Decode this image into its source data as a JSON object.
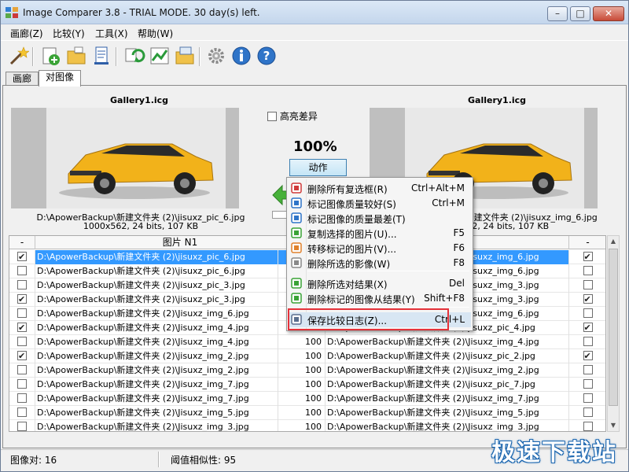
{
  "window": {
    "title": "Image Comparer 3.8 - TRIAL MODE. 30 day(s) left."
  },
  "menu": [
    {
      "label": "画廊(Z)"
    },
    {
      "label": "比较(Y)"
    },
    {
      "label": "工具(X)"
    },
    {
      "label": "帮助(W)"
    }
  ],
  "toolbar": {
    "icons": [
      "magic-wand",
      "add-gallery",
      "open-folder",
      "new-document",
      "refresh-compare",
      "compare-chart",
      "export-folder",
      "settings-gear",
      "info",
      "help"
    ]
  },
  "tabs": [
    {
      "label": "画廊",
      "active": false
    },
    {
      "label": "对图像",
      "active": true
    }
  ],
  "compare": {
    "left": {
      "title": "Gallery1.icg",
      "path": "D:\\ApowerBackup\\新建文件夹 (2)\\jisuxz_pic_6.jpg",
      "info": "1000x562, 24 bits, 107 KB"
    },
    "right": {
      "title": "Gallery1.icg",
      "path": "D:\\ApowerBackup\\新建文件夹 (2)\\jisuxz_img_6.jpg",
      "info": "1000x562, 24 bits, 107 KB"
    },
    "highlight_label": "高亮差异",
    "highlight_checked": false,
    "similarity": "100%",
    "action_label": "动作"
  },
  "table": {
    "headers": {
      "left_check": "-",
      "left": "图片 N1",
      "right_check": "-"
    },
    "rows": [
      {
        "lc": true,
        "left": "D:\\ApowerBackup\\新建文件夹 (2)\\jisuxz_pic_6.jpg",
        "sim": "",
        "right": "D:\\ApowerBackup\\新建文件夹 (2)\\jisuxz_img_6.jpg",
        "rc": true,
        "selected": true
      },
      {
        "lc": false,
        "left": "D:\\ApowerBackup\\新建文件夹 (2)\\jisuxz_pic_6.jpg",
        "sim": "",
        "right": "D:\\ApowerBackup\\新建文件夹 (2)\\jisuxz_img_6.jpg",
        "rc": false
      },
      {
        "lc": false,
        "left": "D:\\ApowerBackup\\新建文件夹 (2)\\jisuxz_pic_3.jpg",
        "sim": "",
        "right": "D:\\ApowerBackup\\新建文件夹 (2)\\jisuxz_img_3.jpg",
        "rc": false
      },
      {
        "lc": true,
        "left": "D:\\ApowerBackup\\新建文件夹 (2)\\jisuxz_pic_3.jpg",
        "sim": "",
        "right": "D:\\ApowerBackup\\新建文件夹 (2)\\jisuxz_img_3.jpg",
        "rc": true
      },
      {
        "lc": false,
        "left": "D:\\ApowerBackup\\新建文件夹 (2)\\Jisuxz_img_6.jpg",
        "sim": "",
        "right": "D:\\ApowerBackup\\新建文件夹 (2)\\jisuxz_img_6.jpg",
        "rc": false
      },
      {
        "lc": true,
        "left": "D:\\ApowerBackup\\新建文件夹 (2)\\Jisuxz_img_4.jpg",
        "sim": "",
        "right": "D:\\ApowerBackup\\新建文件夹 (2)\\jisuxz_pic_4.jpg",
        "rc": true
      },
      {
        "lc": false,
        "left": "D:\\ApowerBackup\\新建文件夹 (2)\\Jisuxz_img_4.jpg",
        "sim": "100",
        "right": "D:\\ApowerBackup\\新建文件夹 (2)\\Jisuxz_img_4.jpg",
        "rc": false
      },
      {
        "lc": true,
        "left": "D:\\ApowerBackup\\新建文件夹 (2)\\jisuxz_img_2.jpg",
        "sim": "100",
        "right": "D:\\ApowerBackup\\新建文件夹 (2)\\jisuxz_pic_2.jpg",
        "rc": true
      },
      {
        "lc": false,
        "left": "D:\\ApowerBackup\\新建文件夹 (2)\\Jisuxz_img_2.jpg",
        "sim": "100",
        "right": "D:\\ApowerBackup\\新建文件夹 (2)\\Jisuxz_img_2.jpg",
        "rc": false
      },
      {
        "lc": false,
        "left": "D:\\ApowerBackup\\新建文件夹 (2)\\Jisuxz_img_7.jpg",
        "sim": "100",
        "right": "D:\\ApowerBackup\\新建文件夹 (2)\\jisuxz_pic_7.jpg",
        "rc": false
      },
      {
        "lc": false,
        "left": "D:\\ApowerBackup\\新建文件夹 (2)\\Jisuxz_img_7.jpg",
        "sim": "100",
        "right": "D:\\ApowerBackup\\新建文件夹 (2)\\Jisuxz_img_7.jpg",
        "rc": false
      },
      {
        "lc": false,
        "left": "D:\\ApowerBackup\\新建文件夹 (2)\\Jisuxz_img_5.jpg",
        "sim": "100",
        "right": "D:\\ApowerBackup\\新建文件夹 (2)\\Jisuxz_img_5.jpg",
        "rc": false
      },
      {
        "lc": false,
        "left": "D:\\ApowerBackup\\新建文件夹 (2)\\Jisuxz_img_3.jpg",
        "sim": "100",
        "right": "D:\\ApowerBackup\\新建文件夹 (2)\\Jisuxz_img_3.jpg",
        "rc": false
      }
    ]
  },
  "context_menu": {
    "items": [
      {
        "label": "删除所有复选框(R)",
        "shortcut": "Ctrl+Alt+M",
        "icon": "checkbox-clear"
      },
      {
        "label": "标记图像质量较好(S)",
        "shortcut": "Ctrl+M",
        "icon": "mark-better"
      },
      {
        "label": "标记图像的质量最差(T)",
        "shortcut": "",
        "icon": "mark-worse"
      },
      {
        "label": "复制选择的图片(U)...",
        "shortcut": "F5",
        "icon": "copy-image"
      },
      {
        "label": "转移标记的图片(V)...",
        "shortcut": "F6",
        "icon": "move-image"
      },
      {
        "label": "删除所选的影像(W)",
        "shortcut": "F8",
        "icon": "delete-image"
      },
      {
        "label": "删除所选对结果(X)",
        "shortcut": "Del",
        "icon": "remove-pair"
      },
      {
        "label": "删除标记的图像从结果(Y)",
        "shortcut": "Shift+F8",
        "icon": "remove-marked"
      },
      {
        "label": "保存比较日志(Z)...",
        "shortcut": "Ctrl+L",
        "icon": "save-log"
      }
    ]
  },
  "status": {
    "pairs": "图像对: 16",
    "threshold": "阈值相似性: 95"
  },
  "watermark": "极速下载站",
  "colors": {
    "selection": "#3399ff",
    "accent_frame": "#e5323a",
    "car": "#f2b21a"
  }
}
